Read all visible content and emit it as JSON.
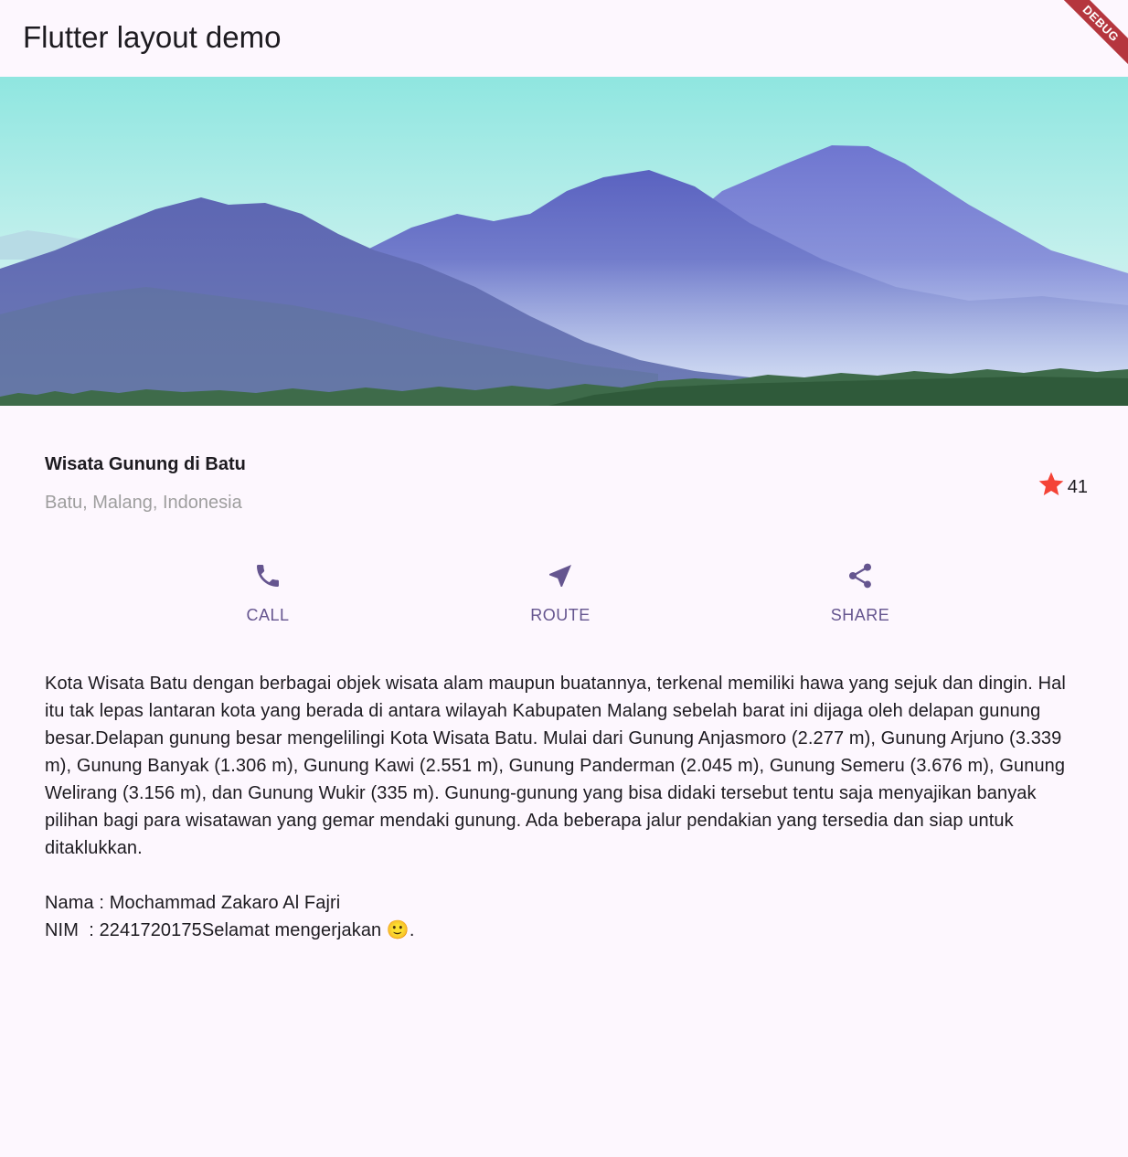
{
  "appbar": {
    "title": "Flutter layout demo",
    "debug_banner": "DEBUG"
  },
  "hero": {
    "alt": "mountain-landscape"
  },
  "title_section": {
    "name": "Wisata Gunung di Batu",
    "location": "Batu, Malang, Indonesia",
    "rating_icon": "star-icon",
    "rating_count": "41"
  },
  "buttons": [
    {
      "label": "CALL",
      "icon": "phone-icon"
    },
    {
      "label": "ROUTE",
      "icon": "near-me-icon"
    },
    {
      "label": "SHARE",
      "icon": "share-icon"
    }
  ],
  "description": "Kota Wisata Batu dengan berbagai objek wisata alam maupun buatannya, terkenal memiliki hawa yang sejuk dan dingin. Hal itu tak lepas lantaran kota yang berada di antara wilayah Kabupaten Malang sebelah barat ini dijaga oleh delapan gunung besar.Delapan gunung besar mengelilingi Kota Wisata Batu. Mulai dari Gunung Anjasmoro (2.277 m), Gunung Arjuno (3.339 m), Gunung Banyak (1.306 m), Gunung Kawi (2.551 m), Gunung Panderman (2.045 m), Gunung Semeru (3.676 m), Gunung Welirang (3.156 m), dan Gunung Wukir (335 m). Gunung-gunung yang bisa didaki tersebut tentu saja menyajikan banyak pilihan bagi para wisatawan yang gemar mendaki gunung. Ada beberapa jalur pendakian yang tersedia dan siap untuk ditaklukkan.\n\nNama : Mochammad Zakaro Al Fajri\nNIM  : 2241720175Selamat mengerjakan 🙂.",
  "colors": {
    "background": "#fdf7fe",
    "primary": "#65558f",
    "star": "#f44336",
    "subtitle": "#9e9e9e",
    "debug": "#b5363e"
  }
}
